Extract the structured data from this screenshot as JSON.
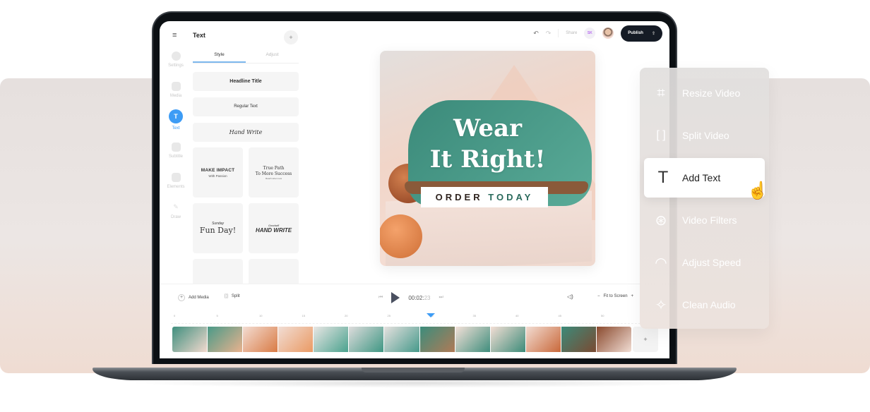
{
  "left_rail": {
    "menu_icon": "hamburger-icon",
    "items": [
      {
        "label": "Settings",
        "icon": "settings-icon"
      },
      {
        "label": "Media",
        "icon": "image-icon"
      },
      {
        "label": "Text",
        "icon": "text-icon",
        "active": true
      },
      {
        "label": "Subtitle",
        "icon": "subtitle-icon"
      },
      {
        "label": "Elements",
        "icon": "elements-icon"
      },
      {
        "label": "Draw",
        "icon": "pencil-icon"
      }
    ]
  },
  "panel": {
    "title": "Text",
    "add_label": "+",
    "tabs": [
      {
        "label": "Style",
        "active": true
      },
      {
        "label": "Adjust"
      }
    ],
    "styles": {
      "headline": "Headline Title",
      "regular": "Regular Text",
      "hand": "Hand Write",
      "make_impact": "MAKE IMPACT",
      "make_impact_sub": "With Passion",
      "true_path": "True Path",
      "true_path_2": "To More Success",
      "true_path_sub": "Reach when new",
      "fun_day_top": "Sunday",
      "fun_day": "Fun Day!",
      "hand_write_top": "Goodwill",
      "hand_write": "HAND WRITE"
    }
  },
  "topbar": {
    "undo_icon": "↶",
    "redo_icon": "↷",
    "share_label": "Share",
    "collab_initials": "SK",
    "publish_label": "Publish",
    "publish_icon": "⇪"
  },
  "canvas": {
    "headline_line1": "Wear",
    "headline_line2": "It Right!",
    "cta_part1": "ORDER",
    "cta_part2": "TODAY"
  },
  "timeline": {
    "add_media_label": "Add Media",
    "split_label": "Split",
    "time_main": "00:02:",
    "time_frames": "23",
    "fit_label": "Fit to Screen",
    "zoom_out": "−",
    "zoom_in": "+",
    "ruler_ticks": [
      "0",
      "5",
      "10",
      "15",
      "20",
      "25",
      "30",
      "35",
      "40",
      "45",
      "50"
    ],
    "playhead_time": 30,
    "add_clip_label": "+",
    "frame_count": 13
  },
  "floating_menu": {
    "items": [
      {
        "label": "Resize Video",
        "icon": "crop-icon",
        "glyph": "⌗"
      },
      {
        "label": "Split Video",
        "icon": "split-icon",
        "glyph": "[ ]"
      },
      {
        "label": "Add Text",
        "icon": "text-icon",
        "glyph": "T",
        "active": true
      },
      {
        "label": "Video Filters",
        "icon": "filters-icon",
        "glyph": "⊛"
      },
      {
        "label": "Adjust Speed",
        "icon": "speedometer-icon",
        "glyph": "◠"
      },
      {
        "label": "Clean Audio",
        "icon": "sparkle-icon",
        "glyph": "✧"
      }
    ]
  },
  "colors": {
    "accent": "#3d9cf5",
    "publish_bg": "#151b25",
    "shoe_teal": "#4a9a88"
  }
}
